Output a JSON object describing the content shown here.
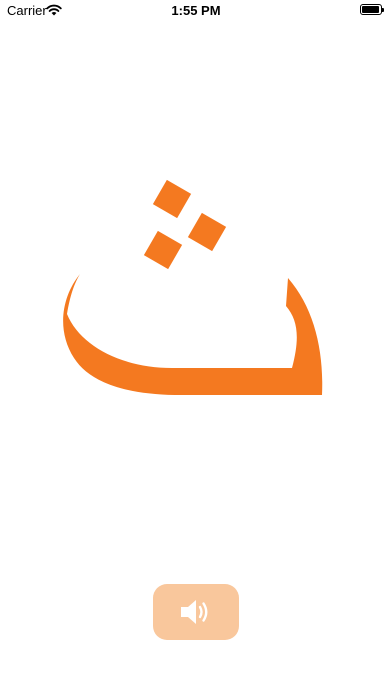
{
  "status_bar": {
    "carrier": "Carrier",
    "time": "1:55 PM",
    "battery_level": 0.95
  },
  "letter": {
    "glyph": "ث",
    "color": "#F47920"
  },
  "audio_button": {
    "background_color": "#F9C79C",
    "icon": "speaker-wave-icon"
  }
}
